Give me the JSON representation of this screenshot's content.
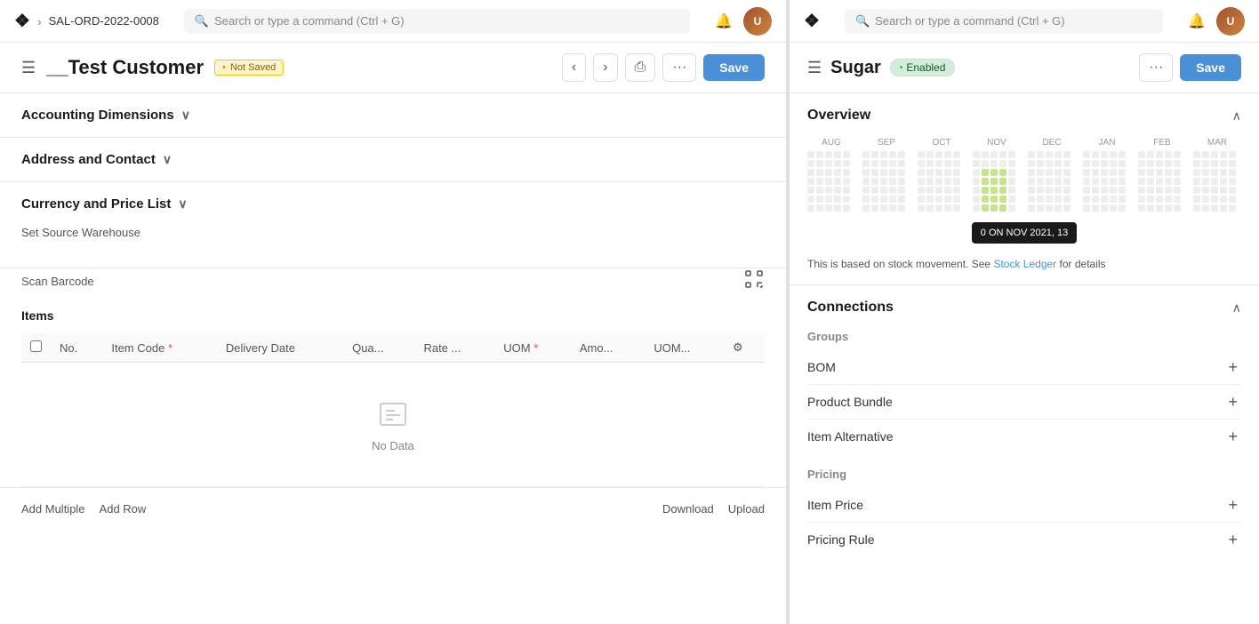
{
  "left": {
    "nav": {
      "breadcrumb": "SAL-ORD-2022-0008",
      "search_placeholder": "Search or type a command (Ctrl + G)"
    },
    "header": {
      "title": "__Test Customer",
      "status": "Not Saved",
      "status_dot": "•",
      "save_label": "Save",
      "menu_icon": "☰",
      "back_icon": "‹",
      "forward_icon": "›",
      "print_icon": "⎙",
      "more_icon": "···"
    },
    "sections": [
      {
        "id": "accounting",
        "label": "Accounting Dimensions",
        "expanded": false
      },
      {
        "id": "address",
        "label": "Address and Contact",
        "expanded": false
      },
      {
        "id": "currency",
        "label": "Currency and Price List",
        "expanded": true
      }
    ],
    "currency_section": {
      "source_warehouse_label": "Set Source Warehouse"
    },
    "barcode": {
      "label": "Scan Barcode",
      "scan_icon": "⊞"
    },
    "items": {
      "label": "Items",
      "columns": [
        {
          "id": "no",
          "label": "No."
        },
        {
          "id": "item_code",
          "label": "Item Code",
          "required": true
        },
        {
          "id": "delivery_date",
          "label": "Delivery Date"
        },
        {
          "id": "quantity",
          "label": "Qua..."
        },
        {
          "id": "rate",
          "label": "Rate ..."
        },
        {
          "id": "uom",
          "label": "UOM",
          "required": true
        },
        {
          "id": "amount",
          "label": "Amo..."
        },
        {
          "id": "uom2",
          "label": "UOM..."
        },
        {
          "id": "settings",
          "label": ""
        }
      ],
      "rows": [],
      "no_data_label": "No Data",
      "add_multiple_label": "Add Multiple",
      "add_row_label": "Add Row",
      "download_label": "Download",
      "upload_label": "Upload"
    }
  },
  "right": {
    "nav": {
      "search_placeholder": "Search or type a command (Ctrl + G)"
    },
    "header": {
      "title": "Sugar",
      "status": "Enabled",
      "status_dot": "•",
      "save_label": "Save",
      "more_icon": "···"
    },
    "overview": {
      "title": "Overview",
      "months": [
        "AUG",
        "SEP",
        "OCT",
        "NOV",
        "DEC",
        "JAN",
        "FEB",
        "MAR"
      ],
      "tooltip": "0 ON NOV 2021, 13",
      "stock_note": "This is based on stock movement. See",
      "stock_link_label": "Stock Ledger",
      "stock_note_suffix": "for details"
    },
    "connections": {
      "title": "Connections",
      "groups": [
        {
          "id": "groups",
          "label": "Groups",
          "items": [
            {
              "id": "bom",
              "label": "BOM"
            },
            {
              "id": "product_bundle",
              "label": "Product Bundle"
            },
            {
              "id": "item_alternative",
              "label": "Item Alternative"
            }
          ]
        },
        {
          "id": "pricing",
          "label": "Pricing",
          "items": [
            {
              "id": "item_price",
              "label": "Item Price"
            },
            {
              "id": "pricing_rule",
              "label": "Pricing Rule"
            }
          ]
        }
      ]
    }
  }
}
